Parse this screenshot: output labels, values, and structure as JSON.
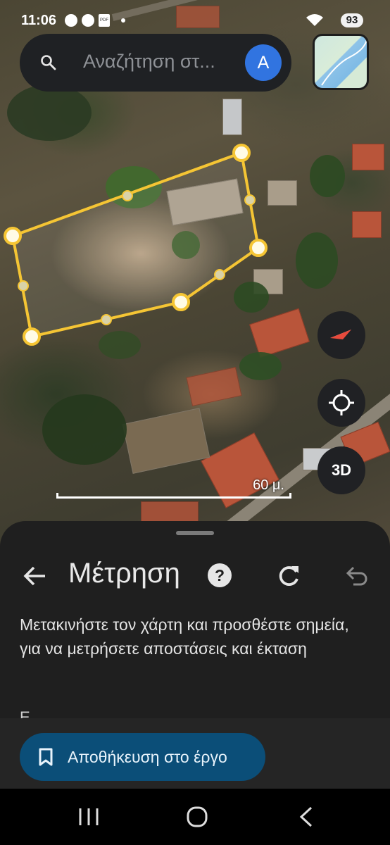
{
  "status_bar": {
    "time": "11:06",
    "battery": "93",
    "notification_icons": [
      "chat-icon",
      "cloud-upload-icon",
      "pdf-icon",
      "dot-icon"
    ],
    "pdf_label": "PDF"
  },
  "search": {
    "placeholder": "Αναζήτηση στ...",
    "avatar_letter": "A"
  },
  "map": {
    "scale_label": "60 μ.",
    "button_3d": "3D",
    "measure_color": "#f5c534"
  },
  "sheet": {
    "title": "Μέτρηση",
    "help": "?",
    "description": "Μετακινήστε τον χάρτη και προσθέστε σημεία, για να μετρήσετε αποστάσεις και έκταση",
    "save_label": "Αποθήκευση στο έργο"
  },
  "colors": {
    "accent_blue": "#3174e0",
    "save_button": "#0b4e78",
    "sheet_background": "#1f1f1f"
  }
}
